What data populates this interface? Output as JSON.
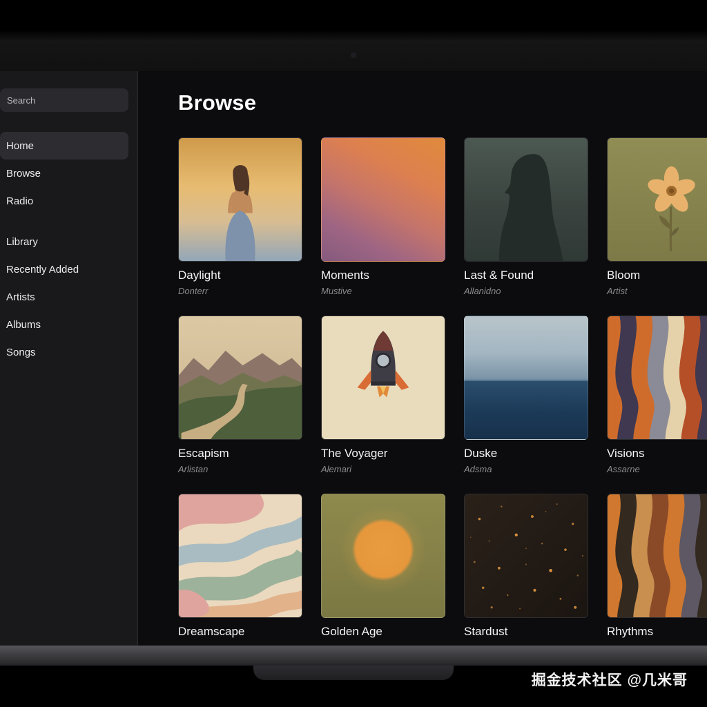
{
  "sidebar": {
    "search_placeholder": "Search",
    "items": [
      {
        "label": "Home",
        "selected": true
      },
      {
        "label": "Browse"
      },
      {
        "label": "Radio"
      },
      {
        "label": "Library"
      },
      {
        "label": "Recently Added"
      },
      {
        "label": "Artists"
      },
      {
        "label": "Albums"
      },
      {
        "label": "Songs"
      }
    ]
  },
  "main": {
    "title": "Browse"
  },
  "albums": [
    {
      "title": "Daylight",
      "artist": "Donterr"
    },
    {
      "title": "Moments",
      "artist": "Mustive"
    },
    {
      "title": "Last & Found",
      "artist": "Allanidno"
    },
    {
      "title": "Bloom",
      "artist": "Artist"
    },
    {
      "title": "Escapism",
      "artist": "Arlistan"
    },
    {
      "title": "The Voyager",
      "artist": "Alemari"
    },
    {
      "title": "Duske",
      "artist": "Adsma"
    },
    {
      "title": "Visions",
      "artist": "Assarne"
    },
    {
      "title": "Dreamscape"
    },
    {
      "title": "Golden Age"
    },
    {
      "title": "Stardust"
    },
    {
      "title": "Rhythms"
    }
  ],
  "watermark": {
    "text": "掘金技术社区 @几米哥"
  },
  "colors": {
    "bg": "#0c0c0e",
    "sidebar_bg": "#19191c",
    "selected_item": "#2d2d31",
    "text": "#ffffff"
  }
}
